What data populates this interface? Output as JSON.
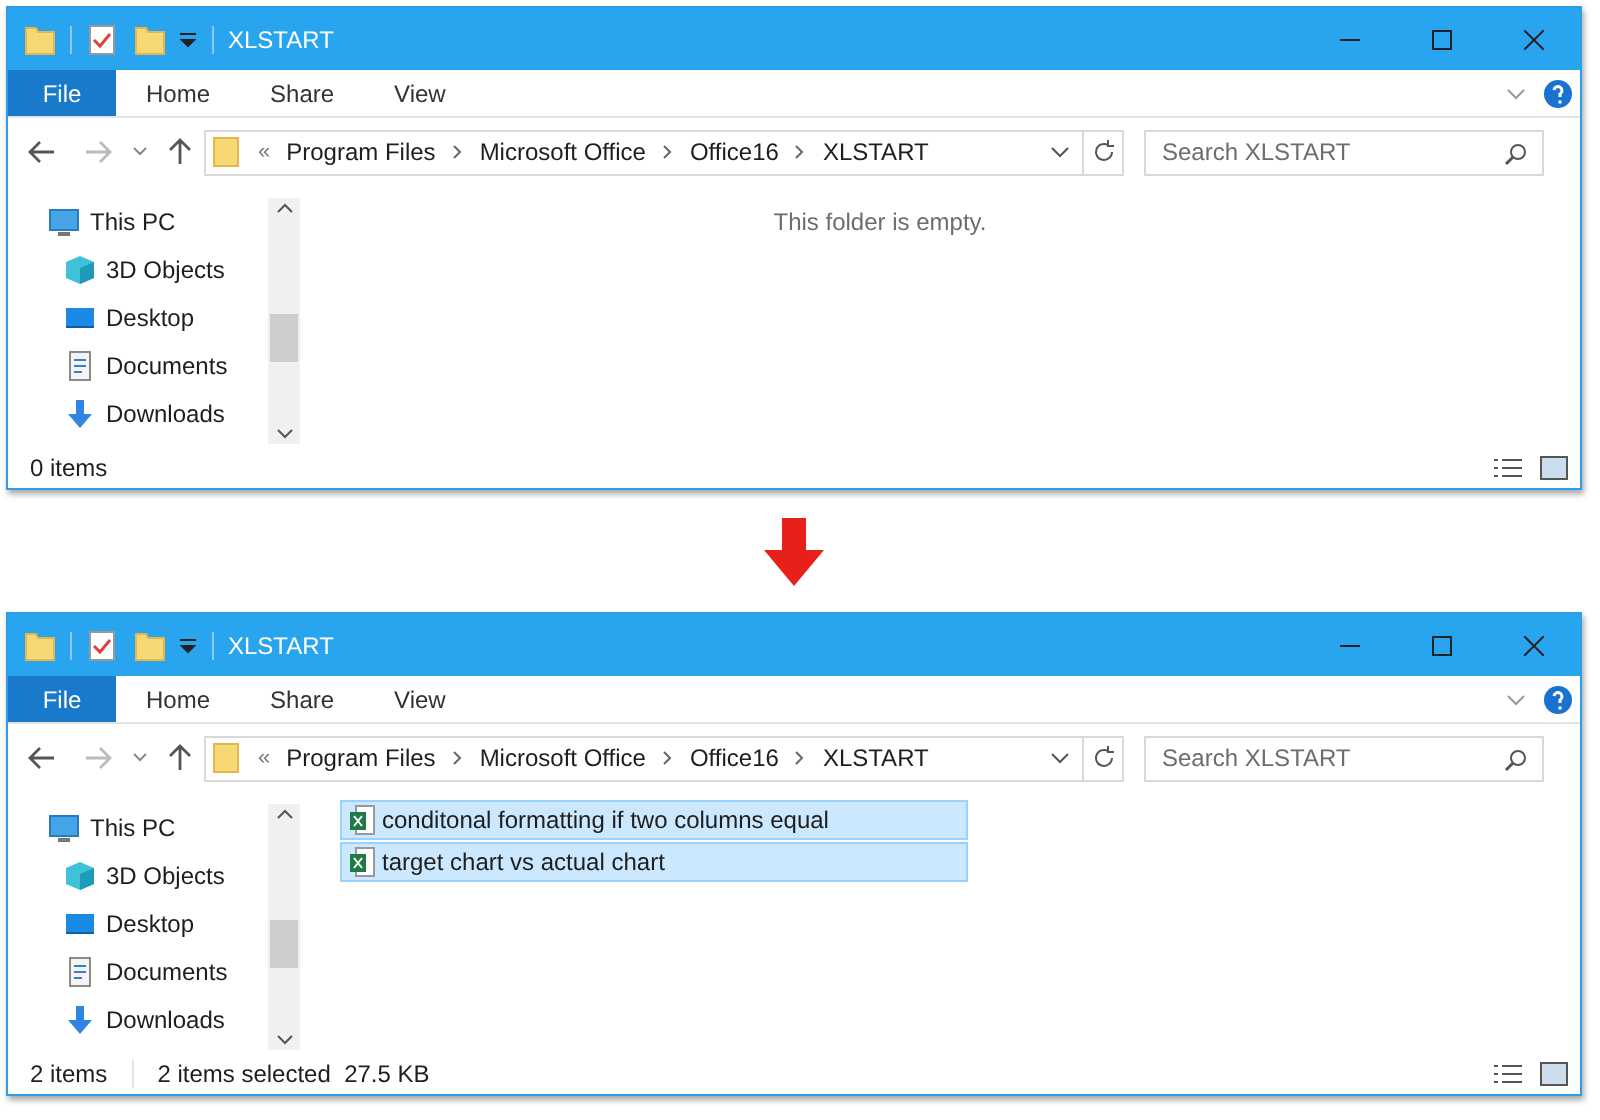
{
  "windows": [
    {
      "title": "XLSTART",
      "file_menu": "File",
      "tabs": [
        "Home",
        "Share",
        "View"
      ],
      "path_prefix": "«",
      "path": [
        "Program Files",
        "Microsoft Office",
        "Office16",
        "XLSTART"
      ],
      "search": {
        "placeholder": "Search XLSTART"
      },
      "nav": [
        {
          "label": "This PC",
          "children": [
            {
              "label": "3D Objects"
            },
            {
              "label": "Desktop"
            },
            {
              "label": "Documents"
            },
            {
              "label": "Downloads"
            }
          ]
        }
      ],
      "empty_message": "This folder is empty.",
      "status": [
        "0 items"
      ]
    },
    {
      "title": "XLSTART",
      "file_menu": "File",
      "tabs": [
        "Home",
        "Share",
        "View"
      ],
      "path_prefix": "«",
      "path": [
        "Program Files",
        "Microsoft Office",
        "Office16",
        "XLSTART"
      ],
      "search": {
        "placeholder": "Search XLSTART"
      },
      "nav": [
        {
          "label": "This PC",
          "children": [
            {
              "label": "3D Objects"
            },
            {
              "label": "Desktop"
            },
            {
              "label": "Documents"
            },
            {
              "label": "Downloads"
            }
          ]
        }
      ],
      "files": [
        {
          "name": "conditonal formatting if two columns equal",
          "selected": true
        },
        {
          "name": "target chart vs actual chart",
          "selected": true
        }
      ],
      "status": [
        "2 items",
        "2 items selected  27.5 KB"
      ]
    }
  ]
}
